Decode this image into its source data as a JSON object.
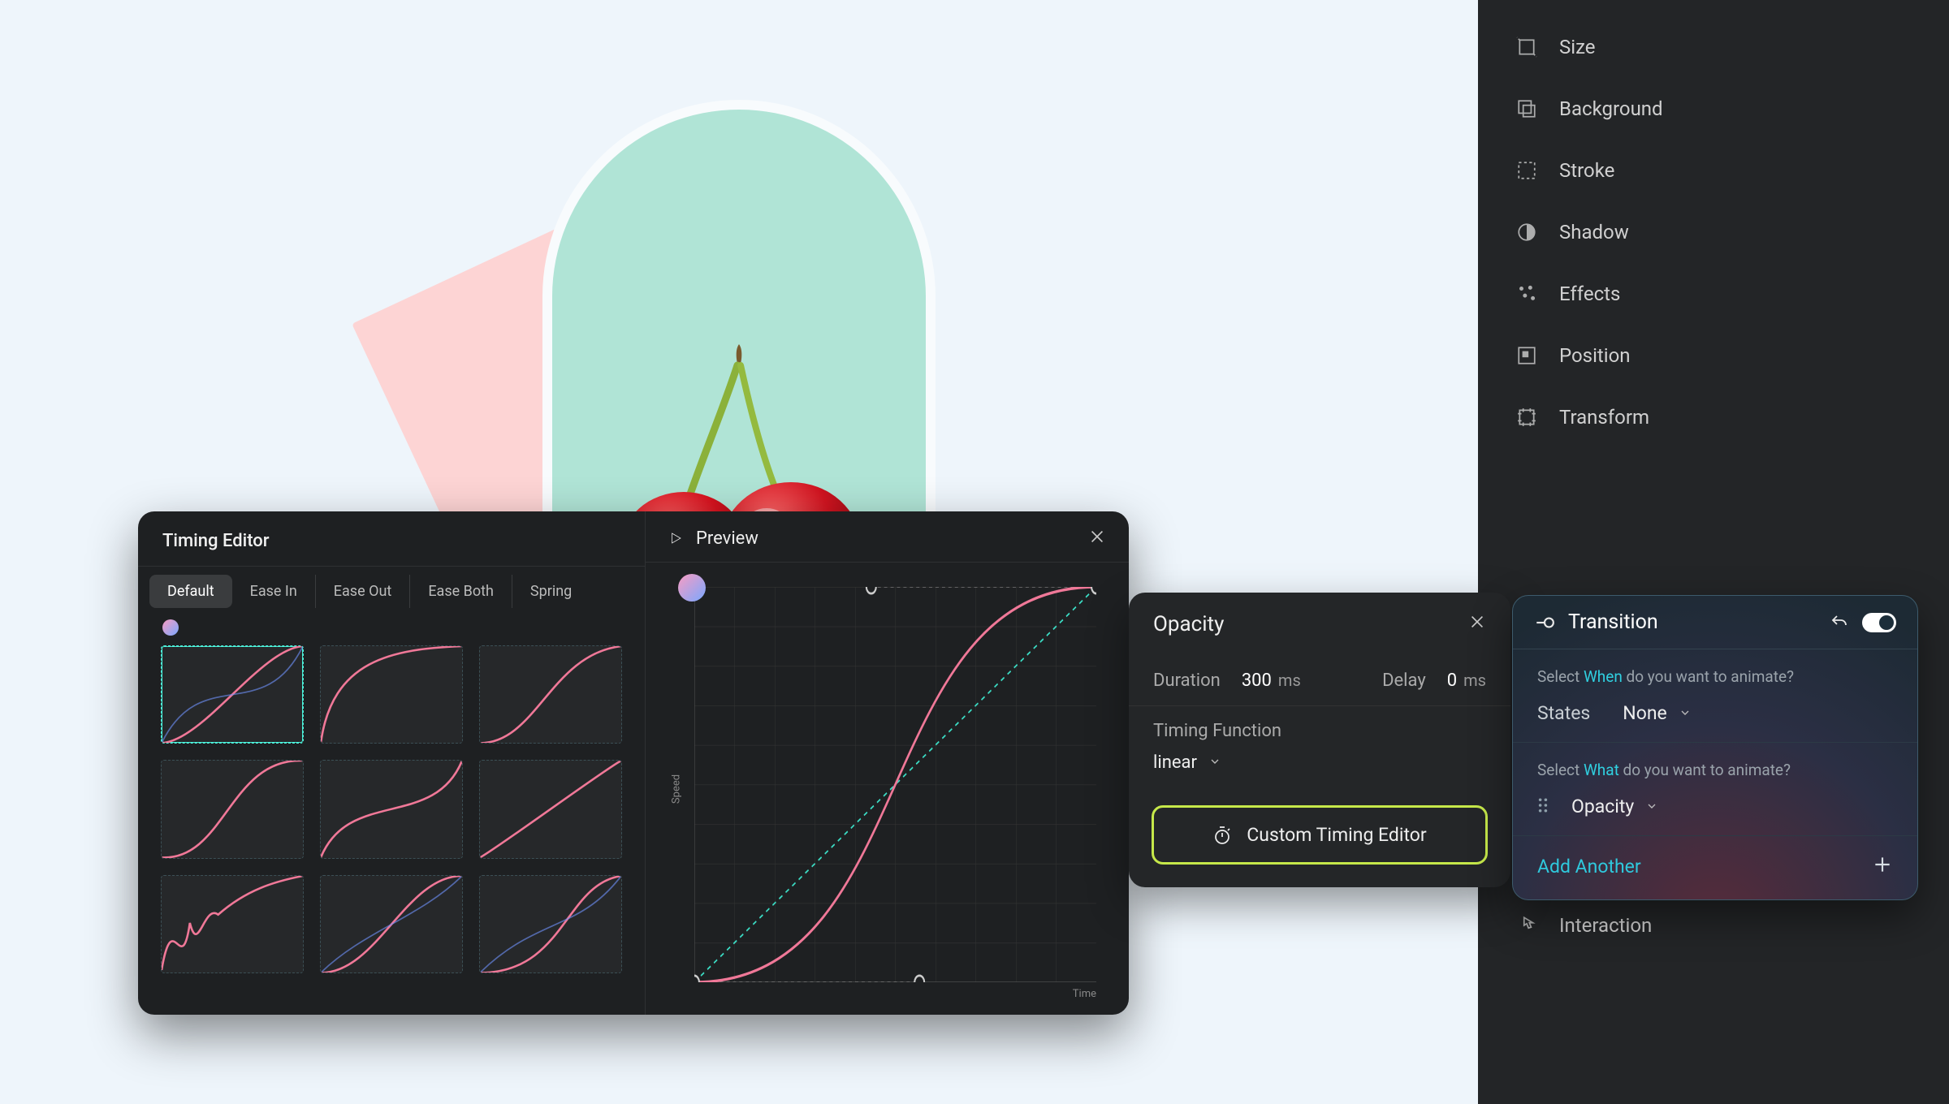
{
  "sidebar": {
    "items": [
      {
        "label": "Size"
      },
      {
        "label": "Background"
      },
      {
        "label": "Stroke"
      },
      {
        "label": "Shadow"
      },
      {
        "label": "Effects"
      },
      {
        "label": "Position"
      },
      {
        "label": "Transform"
      },
      {
        "label": "Interaction"
      }
    ]
  },
  "timing_editor": {
    "title": "Timing Editor",
    "preview_label": "Preview",
    "tabs": [
      "Default",
      "Ease In",
      "Ease Out",
      "Ease Both",
      "Spring"
    ],
    "active_tab": "Default",
    "axis_y": "Speed",
    "axis_x": "Time"
  },
  "opacity_panel": {
    "title": "Opacity",
    "duration_label": "Duration",
    "duration_value": "300",
    "duration_unit": "ms",
    "delay_label": "Delay",
    "delay_value": "0",
    "delay_unit": "ms",
    "timing_function_label": "Timing Function",
    "timing_function_value": "linear",
    "custom_button": "Custom Timing Editor"
  },
  "transition_panel": {
    "title": "Transition",
    "hint_when_pre": "Select ",
    "hint_when_kw": "When",
    "hint_when_post": " do you want to animate?",
    "states_label": "States",
    "states_value": "None",
    "hint_what_pre": "Select ",
    "hint_what_kw": "What",
    "hint_what_post": " do you want to animate?",
    "what_value": "Opacity",
    "add_another": "Add Another"
  },
  "colors": {
    "highlight": "#c6e84a",
    "accent_cyan": "#2fc9dd"
  }
}
